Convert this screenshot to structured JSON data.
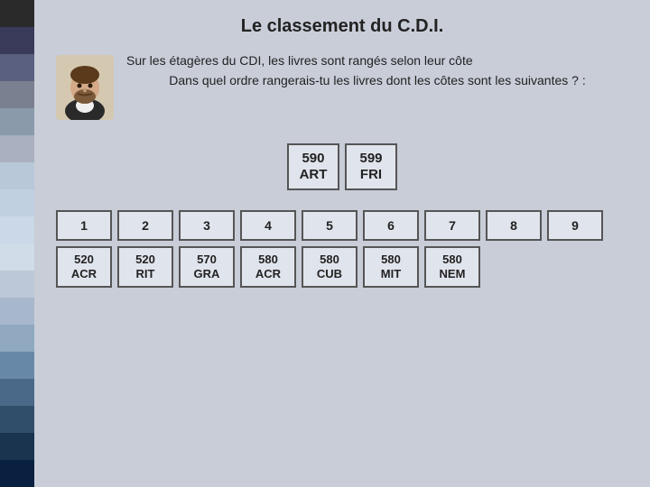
{
  "page": {
    "title": "Le classement du C.D.I.",
    "subtitle1": "Sur les étagères du CDI, les livres sont rangés selon leur côte",
    "subtitle2": "Dans quel ordre rangerais-tu les livres dont les côtes sont les suivantes ? :",
    "strip_colors": [
      "#2a2a2a",
      "#3a3a5a",
      "#5a6080",
      "#7a8090",
      "#8a9aaa",
      "#aab0c0",
      "#b8c8d8",
      "#c0d0e0",
      "#cad8e8",
      "#d0dce8",
      "#bcc8d8",
      "#a8b8cc",
      "#90a8c0",
      "#6888a8",
      "#4a6888",
      "#304e6a",
      "#1a3450",
      "#0a2040"
    ]
  },
  "example_cards": [
    {
      "value": "590\nART"
    },
    {
      "value": "599\nFRI"
    }
  ],
  "order_numbers": [
    {
      "label": "1"
    },
    {
      "label": "2"
    },
    {
      "label": "3"
    },
    {
      "label": "4"
    },
    {
      "label": "5"
    },
    {
      "label": "6"
    },
    {
      "label": "7"
    },
    {
      "label": "8"
    },
    {
      "label": "9"
    }
  ],
  "order_books": [
    {
      "value": "520\nACR"
    },
    {
      "value": "520\nRIT"
    },
    {
      "value": "570\nGRA"
    },
    {
      "value": "580\nACR"
    },
    {
      "value": "580\nCUB"
    },
    {
      "value": "580\nMIT"
    },
    {
      "value": "580\nNEM"
    },
    {
      "value": ""
    },
    {
      "value": ""
    }
  ]
}
